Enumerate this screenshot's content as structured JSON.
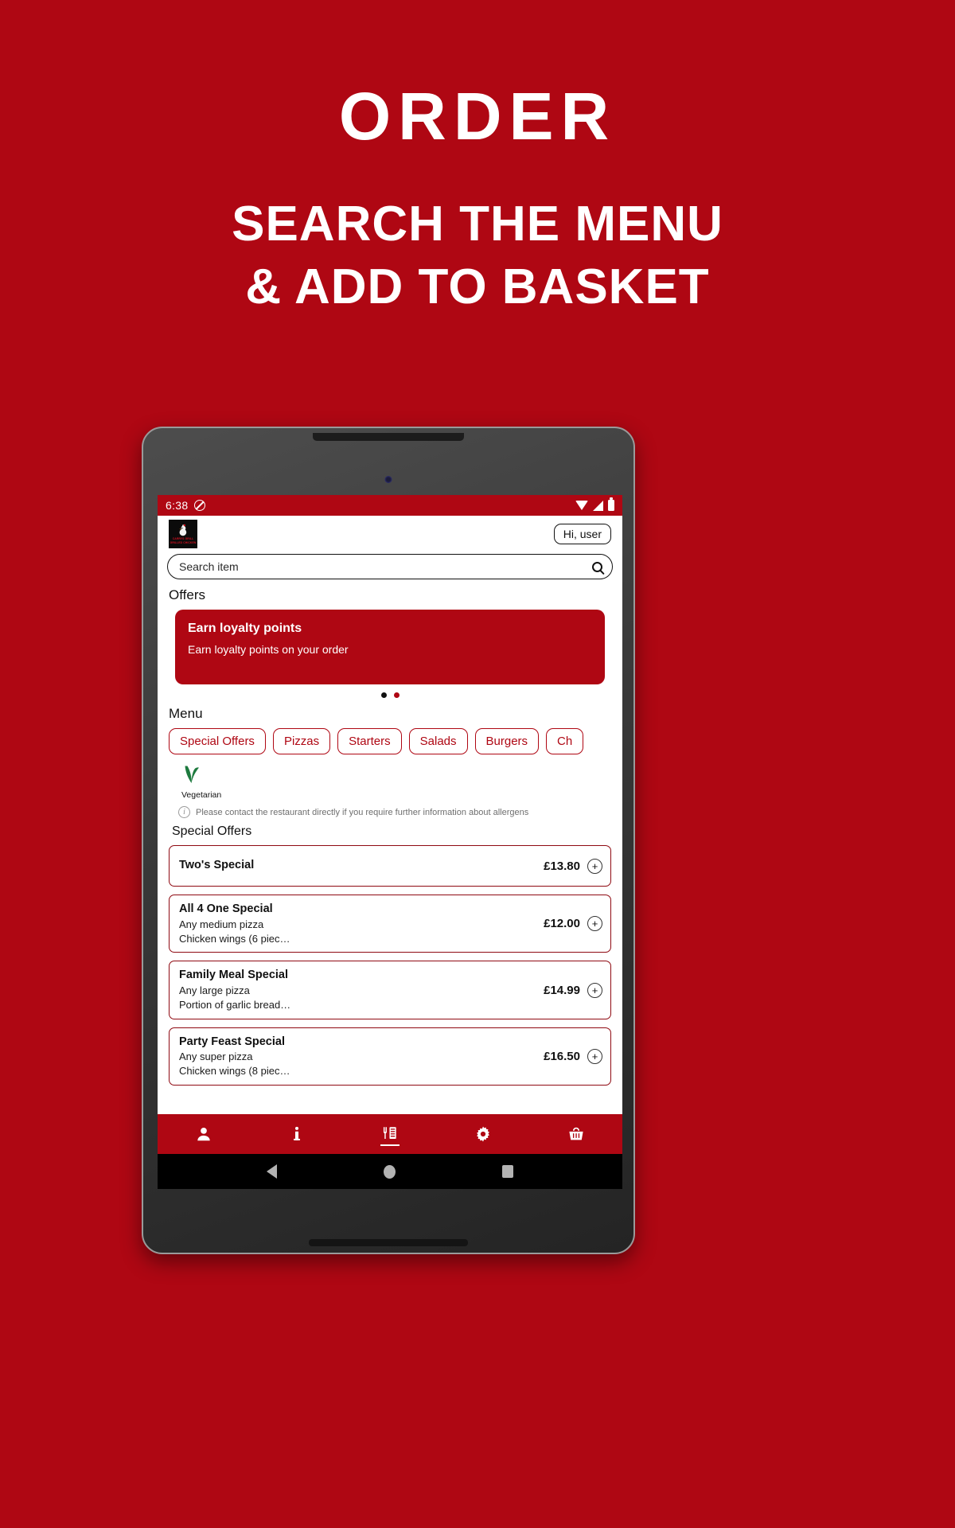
{
  "promo": {
    "title": "ORDER",
    "subtitle_line1": "SEARCH THE MENU",
    "subtitle_line2": "& ADD TO BASKET",
    "background_color": "#AF0713",
    "text_color": "#FFFFFF"
  },
  "statusbar": {
    "time": "6:38",
    "dnd_icon": "do-not-disturb-icon",
    "wifi_icon": "wifi-icon",
    "signal_icon": "signal-icon",
    "battery_icon": "battery-icon"
  },
  "header": {
    "logo_line1": "CARRYS GRILL",
    "logo_line2": "GRILLED CHICKEN",
    "logo_icon": "chicken-logo-icon",
    "account_label": "Hi, user"
  },
  "search": {
    "placeholder": "Search item",
    "value": "",
    "icon": "search-icon"
  },
  "offers": {
    "heading": "Offers",
    "card": {
      "title": "Earn loyalty points",
      "subtitle": "Earn loyalty points on your order",
      "background_color": "#AF0713"
    },
    "dots": [
      {
        "state": "dark"
      },
      {
        "state": "red"
      }
    ]
  },
  "menu": {
    "heading": "Menu",
    "categories": [
      {
        "label": "Special Offers",
        "selected": true
      },
      {
        "label": "Pizzas",
        "selected": false
      },
      {
        "label": "Starters",
        "selected": false
      },
      {
        "label": "Salads",
        "selected": false
      },
      {
        "label": "Burgers",
        "selected": false
      },
      {
        "label": "Ch",
        "selected": false
      }
    ],
    "legend": {
      "veg_icon": "vegetarian-leaf-icon",
      "veg_label": "Vegetarian",
      "allergen_icon": "info-icon",
      "allergen_text": "Please contact the restaurant directly if you require further information about allergens"
    },
    "section_title": "Special Offers",
    "items": [
      {
        "name": "Two's Special",
        "desc_line1": "",
        "desc_line2": "",
        "price": "£13.80",
        "add_label": "+"
      },
      {
        "name": "All 4 One Special",
        "desc_line1": "Any medium pizza",
        "desc_line2": "Chicken wings (6 piec…",
        "price": "£12.00",
        "add_label": "+"
      },
      {
        "name": "Family Meal Special",
        "desc_line1": "Any large pizza",
        "desc_line2": "Portion of garlic bread…",
        "price": "£14.99",
        "add_label": "+"
      },
      {
        "name": "Party Feast Special",
        "desc_line1": "Any super pizza",
        "desc_line2": "Chicken wings (8 piec…",
        "price": "£16.50",
        "add_label": "+"
      }
    ]
  },
  "bottom_nav": {
    "background_color": "#AF0713",
    "items": [
      {
        "icon": "account-icon",
        "active": false
      },
      {
        "icon": "info-icon",
        "active": false
      },
      {
        "icon": "menu-icon",
        "active": true
      },
      {
        "icon": "settings-gear-icon",
        "active": false
      },
      {
        "icon": "basket-icon",
        "active": false
      }
    ]
  },
  "system_nav": {
    "back_icon": "back-triangle-icon",
    "home_icon": "home-circle-icon",
    "recents_icon": "recents-square-icon"
  }
}
